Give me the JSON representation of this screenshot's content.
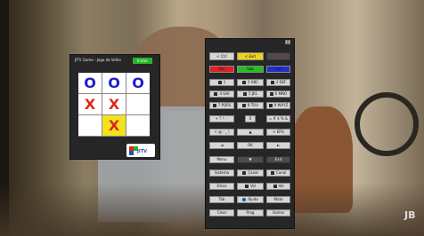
{
  "tv_logo": "JB",
  "ttt": {
    "title": "JITV Game - Jogo da Velha",
    "start_label": "Iniciar",
    "board": [
      [
        "O",
        "O",
        "O"
      ],
      [
        "X",
        "X",
        ""
      ],
      [
        "",
        "X",
        ""
      ]
    ],
    "highlight_cell": 7,
    "logo_text": "JITV",
    "colors": {
      "o": "#1d1fc8",
      "x": "#e2251c",
      "highlight": "#f1e31d",
      "start": "#28b428"
    }
  },
  "remote": {
    "close_label": "x",
    "top": {
      "left": "< Ctrl",
      "center": "< Exit",
      "right": "= Ir"
    },
    "colors": [
      "#e02020",
      "#20c020",
      "#2030d0"
    ],
    "color_labels": [
      "Rec",
      "Sub",
      "Lst"
    ],
    "keys": [
      "1",
      "2 ABC",
      "3 DEF",
      "4 GHI",
      "5 JKL",
      "6 MNO",
      "7 PQRS",
      "8 TUV",
      "9 WXYZ"
    ],
    "sym_row": [
      "+ ? ! ; -",
      "0",
      "= # $ % &"
    ],
    "nav": {
      "left_sym": "< @ - _ \\",
      "up": "▲",
      "right_sym": "> EPG",
      "left": "◄",
      "ok": "OK",
      "right": "►",
      "down": "▼",
      "menu": "Menu",
      "exit": "Exit"
    },
    "func_rows": [
      [
        "Sistema",
        "Canal",
        "Canal"
      ],
      [
        "Disco",
        "Vol",
        "Vol"
      ],
      [
        "Tab",
        "Ajuda",
        "Mute"
      ],
      [
        "Clear",
        "Prog",
        "Outros"
      ]
    ]
  }
}
